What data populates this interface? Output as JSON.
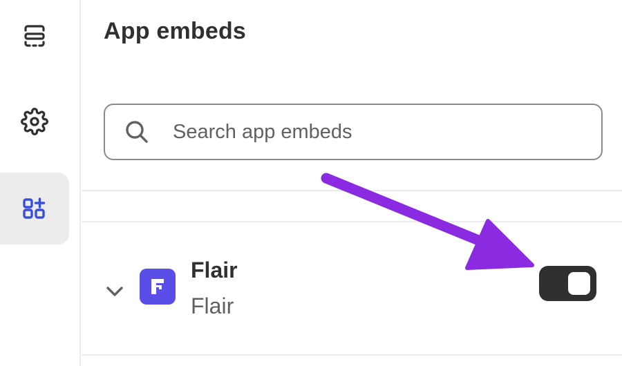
{
  "sidebar": {
    "items": [
      {
        "icon": "sections-icon",
        "active": false
      },
      {
        "icon": "gear-icon",
        "active": false
      },
      {
        "icon": "app-embeds-icon",
        "active": true
      }
    ]
  },
  "main": {
    "title": "App embeds",
    "search": {
      "placeholder": "Search app embeds",
      "value": ""
    },
    "embeds": [
      {
        "name": "Flair",
        "subtitle": "Flair",
        "logo_color": "#5b4de8",
        "enabled": true
      }
    ]
  },
  "annotation": {
    "type": "arrow",
    "color": "#8a2be2"
  }
}
